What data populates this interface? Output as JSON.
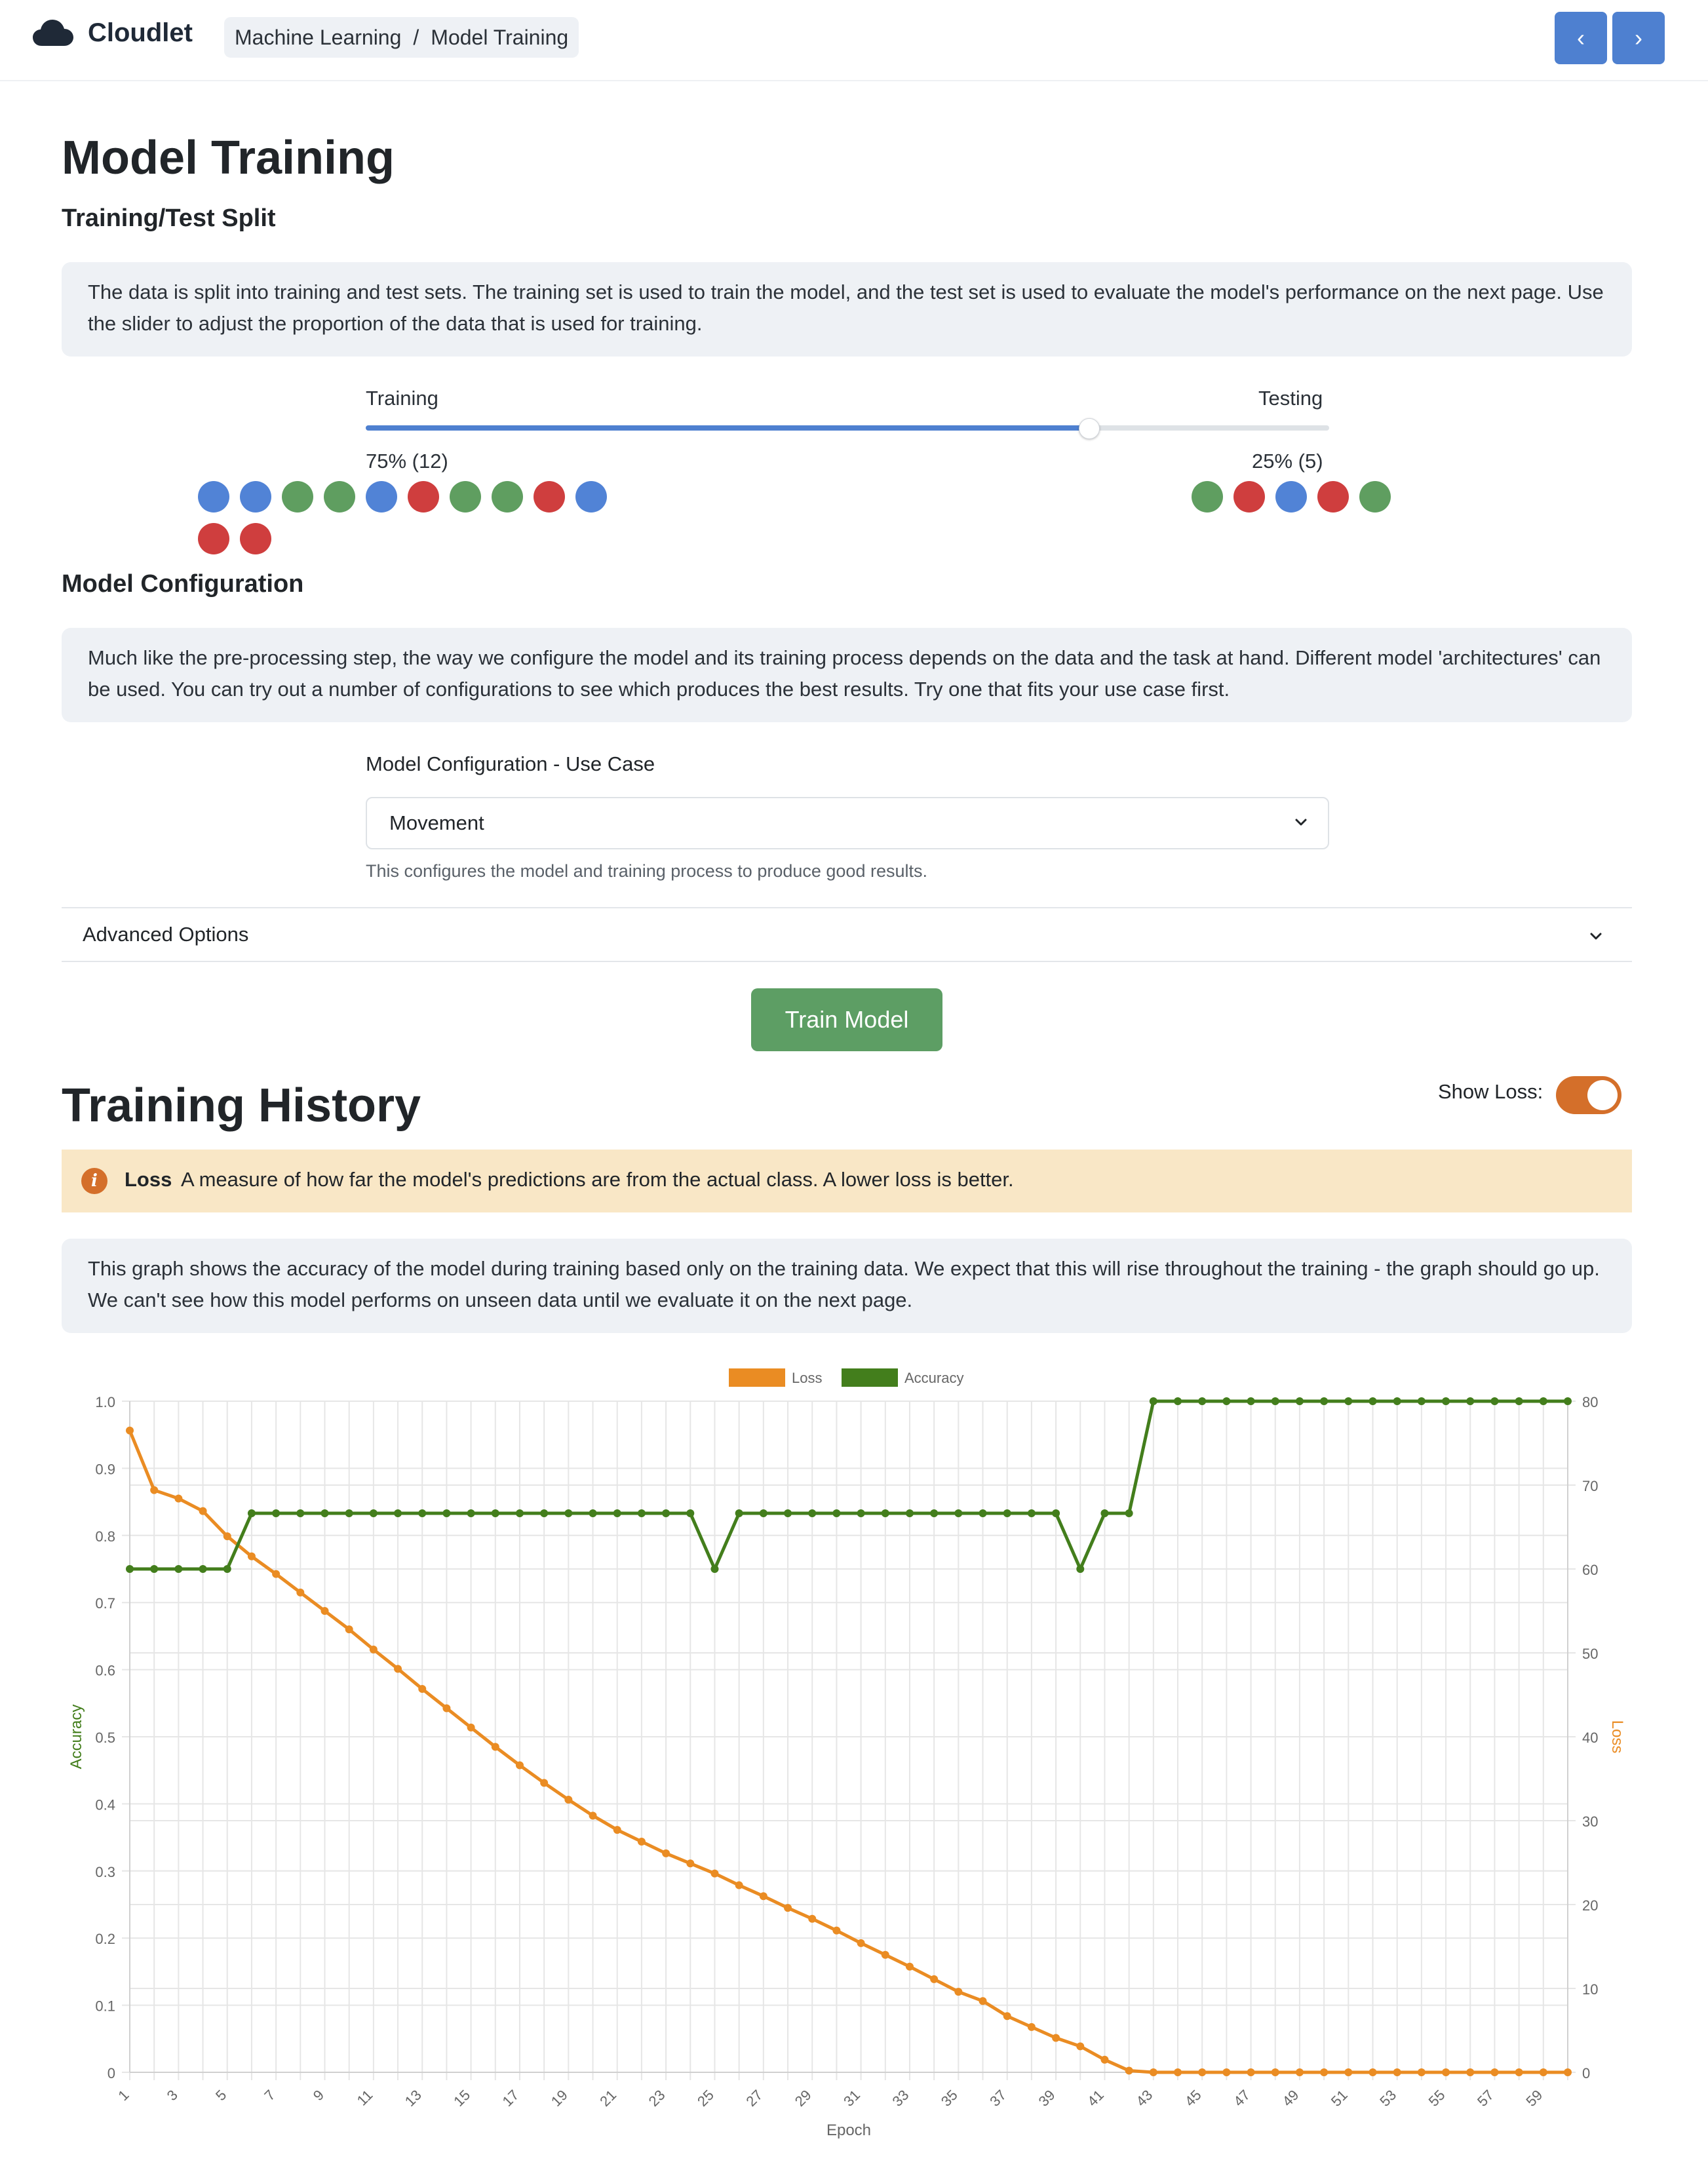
{
  "header": {
    "app_name": "Cloudlet",
    "breadcrumb": [
      "Machine Learning",
      "Model Training"
    ],
    "breadcrumb_sep": "/",
    "prev_icon": "chevron-left-icon",
    "next_icon": "chevron-right-icon",
    "prev_label": "‹",
    "next_label": "›",
    "accent_color": "#4e80d0"
  },
  "page": {
    "title": "Model Training"
  },
  "split": {
    "heading": "Training/Test Split",
    "description": "The data is split into training and test sets. The training set is used to train the model, and the test set is used to evaluate the model's performance on the next page. Use the slider to adjust the proportion of the data that is used for training.",
    "training_label": "Training",
    "testing_label": "Testing",
    "training_value": "75% (12)",
    "testing_value": "25% (5)",
    "train_fraction": 0.75,
    "colors": {
      "blue": "#5183d6",
      "green": "#5f9e60",
      "red": "#cf3e3e"
    },
    "training_dots": [
      "blue",
      "blue",
      "green",
      "green",
      "blue",
      "red",
      "green",
      "green",
      "red",
      "blue",
      "red",
      "red"
    ],
    "testing_dots": [
      "green",
      "red",
      "blue",
      "red",
      "green"
    ]
  },
  "config": {
    "heading": "Model Configuration",
    "description": "Much like the pre-processing step, the way we configure the model and its training process depends on the data and the task at hand. Different model 'architectures' can be used. You can try out a number of configurations to see which produces the best results. Try one that fits your use case first.",
    "field_label": "Model Configuration - Use Case",
    "selected": "Movement",
    "help": "This configures the model and training process to produce good results.",
    "advanced_label": "Advanced Options",
    "train_button": "Train Model",
    "train_button_color": "#5d9e64"
  },
  "history": {
    "heading": "Training History",
    "toggle_label": "Show Loss:",
    "toggle_on": true,
    "alert_title": "Loss",
    "alert_text": "A measure of how far the model's predictions are from the actual class. A lower loss is better.",
    "alert_icon": "info-icon",
    "alert_icon_glyph": "i",
    "description": "This graph shows the accuracy of the model during training based only on the training data. We expect that this will rise throughout the training - the graph should go up. We can't see how this model performs on unseen data until we evaluate it on the next page."
  },
  "chart_data": {
    "type": "line",
    "xlabel": "Epoch",
    "ylabel_left": "Accuracy",
    "ylabel_right": "Loss",
    "legend_position": "top-center",
    "grid": true,
    "ylim_left": [
      0,
      1.0
    ],
    "ylim_right": [
      0,
      80
    ],
    "yticks_left": [
      "0",
      "0.1",
      "0.2",
      "0.3",
      "0.4",
      "0.5",
      "0.6",
      "0.7",
      "0.8",
      "0.9",
      "1.0"
    ],
    "yticks_right": [
      "0",
      "10",
      "20",
      "30",
      "40",
      "50",
      "60",
      "70",
      "80"
    ],
    "x": [
      1,
      2,
      3,
      4,
      5,
      6,
      7,
      8,
      9,
      10,
      11,
      12,
      13,
      14,
      15,
      16,
      17,
      18,
      19,
      20,
      21,
      22,
      23,
      24,
      25,
      26,
      27,
      28,
      29,
      30,
      31,
      32,
      33,
      34,
      35,
      36,
      37,
      38,
      39,
      40,
      41,
      42,
      43,
      44,
      45,
      46,
      47,
      48,
      49,
      50,
      51,
      52,
      53,
      54,
      55,
      56,
      57,
      58,
      59,
      60
    ],
    "xtick_labels": [
      "1",
      "3",
      "5",
      "7",
      "9",
      "11",
      "13",
      "15",
      "17",
      "19",
      "21",
      "23",
      "25",
      "27",
      "29",
      "31",
      "33",
      "35",
      "37",
      "39",
      "41",
      "43",
      "45",
      "47",
      "49",
      "51",
      "53",
      "55",
      "57",
      "59"
    ],
    "series": [
      {
        "name": "Loss",
        "axis": "right",
        "color": "#ea8c23",
        "values": [
          76.5,
          69.4,
          68.4,
          66.9,
          63.9,
          61.5,
          59.4,
          57.2,
          55.0,
          52.8,
          50.4,
          48.1,
          45.7,
          43.4,
          41.1,
          38.8,
          36.6,
          34.5,
          32.5,
          30.6,
          28.9,
          27.5,
          26.1,
          24.9,
          23.7,
          22.3,
          21.0,
          19.6,
          18.3,
          16.9,
          15.4,
          14.0,
          12.6,
          11.1,
          9.6,
          8.5,
          6.7,
          5.4,
          4.1,
          3.1,
          1.5,
          0.2,
          0,
          0,
          0,
          0,
          0,
          0,
          0,
          0,
          0,
          0,
          0,
          0,
          0,
          0,
          0,
          0,
          0,
          0
        ]
      },
      {
        "name": "Accuracy",
        "axis": "left",
        "color": "#437e1c",
        "values": [
          0.75,
          0.75,
          0.75,
          0.75,
          0.75,
          0.833,
          0.833,
          0.833,
          0.833,
          0.833,
          0.833,
          0.833,
          0.833,
          0.833,
          0.833,
          0.833,
          0.833,
          0.833,
          0.833,
          0.833,
          0.833,
          0.833,
          0.833,
          0.833,
          0.75,
          0.833,
          0.833,
          0.833,
          0.833,
          0.833,
          0.833,
          0.833,
          0.833,
          0.833,
          0.833,
          0.833,
          0.833,
          0.833,
          0.833,
          0.75,
          0.833,
          0.833,
          1.0,
          1.0,
          1.0,
          1.0,
          1.0,
          1.0,
          1.0,
          1.0,
          1.0,
          1.0,
          1.0,
          1.0,
          1.0,
          1.0,
          1.0,
          1.0,
          1.0,
          1.0
        ]
      }
    ]
  }
}
